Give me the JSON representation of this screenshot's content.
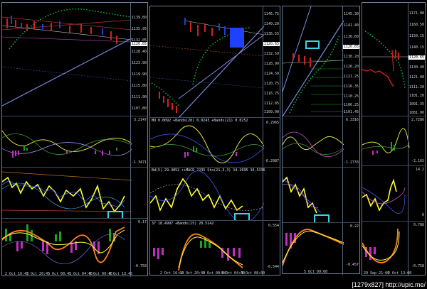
{
  "windows": [
    {
      "id": "w1",
      "price_ticks": [
        "1139.60",
        "1135.95",
        "1132.05",
        "1128.40",
        "1123.90",
        "1119.90",
        "1115.80",
        "1111.90",
        "1107.80"
      ],
      "price_label": "1120.65",
      "ind1_ticks": [
        "3.2147",
        "-1.3471"
      ],
      "ind2_ticks": [],
      "ind3_ticks": [
        "0.17",
        "-0.759"
      ],
      "time_labels": [
        "2 Oct 16:45",
        "2 Oct 20:45",
        "5 Oct 00:45",
        "5 Oct 04:45",
        "5 Oct 09:45",
        "5 Oct 13:45"
      ]
    },
    {
      "id": "w2",
      "price_ticks": [
        "1146.75",
        "1140.20",
        "1136.55",
        "1132.50",
        "1128.90",
        "1124.50",
        "1120.75",
        "1116.75",
        "1112.85",
        "1109.00",
        "1104.95"
      ],
      "price_label": "1120.65",
      "ind1_text": "MO 0.0092 +Bands(20) 0.0243 +Bands(21) 0.0252",
      "ind1_ticks": [
        "0.2965",
        "-0.2987"
      ],
      "ind2_text": "Bd(5) 29.4052 ++MACD 2235 Sto(21,3,3) 14.2095 16.5336",
      "ind2_ticks": [],
      "ind3_text": "37 18.4997 +Bands(15) 20.5142",
      "ind3_ticks": [
        "0.554",
        "-0.544"
      ],
      "time_labels": [
        "2 Oct 16:00",
        "2 Oct 20:00",
        "5 Oct 00:00",
        "5 Oct 04:00",
        "5 Oct 08:00"
      ]
    },
    {
      "id": "w3",
      "price_ticks": [
        "1145.30",
        "1141.40",
        "1136.60",
        "1130.20",
        "1126.20",
        "1121.25",
        "1116.35",
        "1110.25",
        "1106.25",
        "1101.45"
      ],
      "price_label": "1120.65",
      "ind1_ticks": [
        "6.3316",
        "-1.2733"
      ],
      "ind2_ticks": [],
      "ind3_ticks": [
        "0.22",
        "-0.457"
      ],
      "time_labels": [
        "5 Oct 09:00"
      ]
    },
    {
      "id": "w4",
      "price_ticks": [
        "1171.00",
        "1160.50",
        "1150.15",
        "1140.15",
        "1130.40",
        "1121.00",
        "1111.20",
        "1101.20",
        "1091.35",
        "1081.00"
      ],
      "price_label": "1120.65",
      "ind1_ticks": [
        "2.7286",
        "-2.16S"
      ],
      "ind2_ticks": [
        "14.2",
        "0"
      ],
      "ind3_ticks": [
        "0.788",
        "-0.758"
      ],
      "time_labels": [
        "29 Sep 21:00",
        "2 Oct 13:00"
      ]
    }
  ],
  "credit": "[1279x827] http://upic.me/"
}
